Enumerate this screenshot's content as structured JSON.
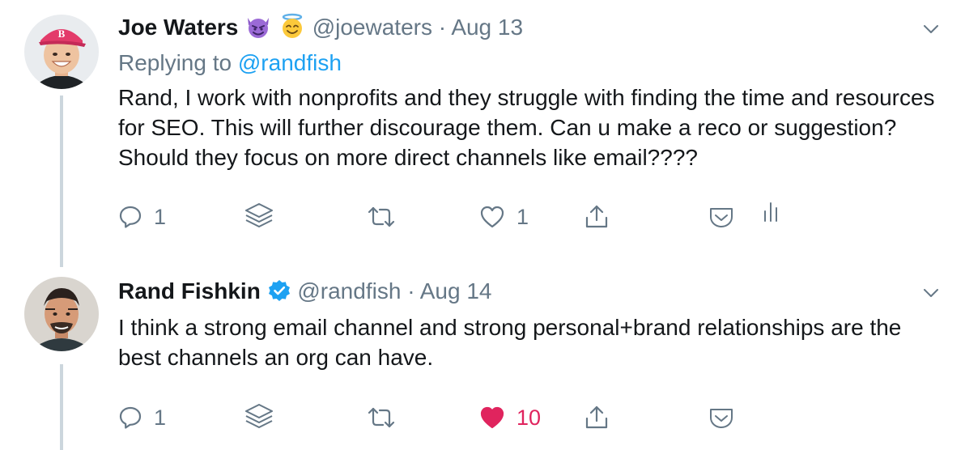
{
  "tweets": [
    {
      "name": "Joe Waters",
      "handle": "@joewaters",
      "separator": "·",
      "date": "Aug 13",
      "reply_prefix": "Replying to ",
      "reply_handle": "@randfish",
      "text": "Rand, I work with nonprofits and they struggle with finding the time and resources for SEO. This will further discourage them. Can u make a reco or suggestion? Should they focus on more direct channels like email????",
      "reply_count": "1",
      "like_count": "1",
      "liked": false
    },
    {
      "name": "Rand Fishkin",
      "handle": "@randfish",
      "separator": "·",
      "date": "Aug 14",
      "text": "I think a strong email channel and strong personal+brand relationships are the best channels an org can have.",
      "reply_count": "1",
      "like_count": "10",
      "liked": true
    }
  ],
  "icons": {
    "reply": "speech-bubble-icon",
    "stack": "layers-icon",
    "retweet": "retweet-icon",
    "like": "heart-icon",
    "share": "share-icon",
    "save": "pocket-icon",
    "analytics": "analytics-icon",
    "menu": "chevron-down-icon",
    "verified": "verified-badge-icon"
  },
  "colors": {
    "name": "#14171a",
    "secondary": "#657786",
    "link": "#1da1f2",
    "liked": "#e0245e",
    "verified": "#1da1f2",
    "thread_line": "#ccd6dd"
  }
}
